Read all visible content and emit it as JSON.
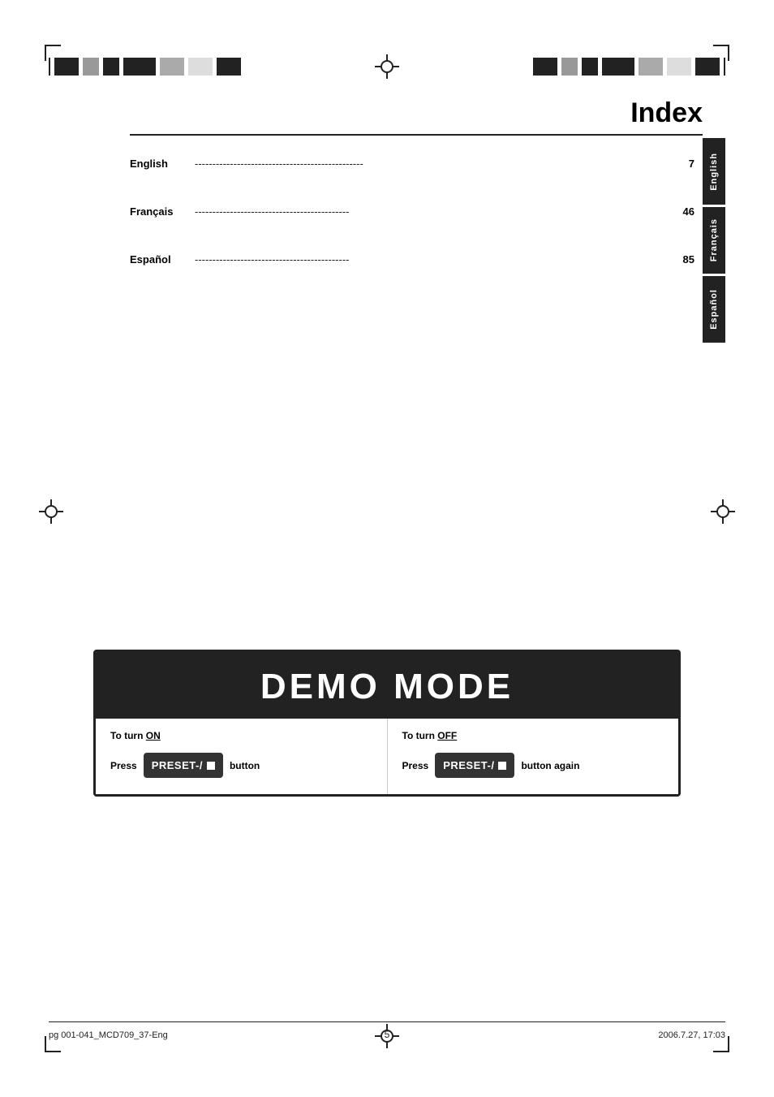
{
  "page": {
    "title": "Index",
    "page_number": "5"
  },
  "top_bar": {
    "crosshair_label": "crosshair"
  },
  "index": {
    "title": "Index",
    "entries": [
      {
        "label": "English",
        "dots": "------------------------------------------------",
        "page": "7"
      },
      {
        "label": "Français",
        "dots": "--------------------------------------------",
        "page": "46"
      },
      {
        "label": "Español",
        "dots": "--------------------------------------------",
        "page": "85"
      }
    ],
    "tabs": [
      {
        "label": "English"
      },
      {
        "label": "Français"
      },
      {
        "label": "Español"
      }
    ]
  },
  "demo": {
    "title": "DEMO MODE",
    "turn_on": {
      "label": "To turn ON",
      "on_word": "ON"
    },
    "turn_off": {
      "label": "To turn OFF",
      "off_word": "OFF"
    },
    "press_label": "Press",
    "button_name": "PRESET-/",
    "button_suffix": "button",
    "button_again": "button again"
  },
  "footer": {
    "left": "pg 001-041_MCD709_37-Eng",
    "center": "5",
    "right": "2006.7.27, 17:03"
  }
}
